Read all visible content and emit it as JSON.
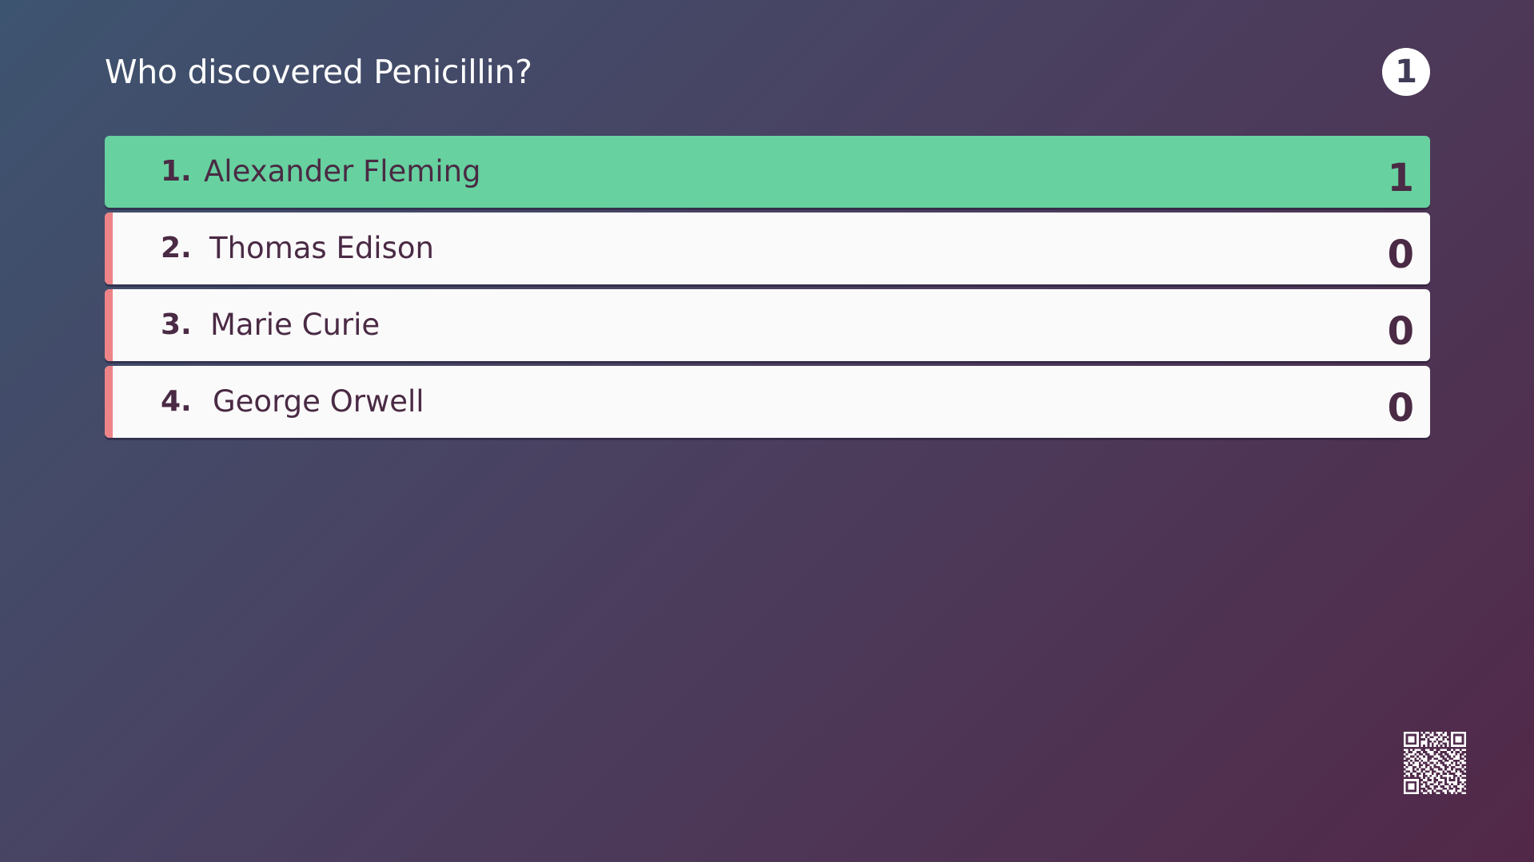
{
  "question": {
    "text": "Who discovered Penicillin?",
    "response_count": "1"
  },
  "answers": [
    {
      "number": "1.",
      "label": "Alexander Fleming",
      "votes": "1",
      "correct": true
    },
    {
      "number": "2.",
      "label": "Thomas Edison",
      "votes": "0",
      "correct": false
    },
    {
      "number": "3.",
      "label": "Marie Curie",
      "votes": "0",
      "correct": false
    },
    {
      "number": "4.",
      "label": "George Orwell",
      "votes": "0",
      "correct": false
    }
  ],
  "colors": {
    "correct": "#67d19f",
    "incorrect_stripe": "#ee8487",
    "text": "#4a2a44"
  },
  "icons": {
    "qr": "qr-code-icon"
  }
}
